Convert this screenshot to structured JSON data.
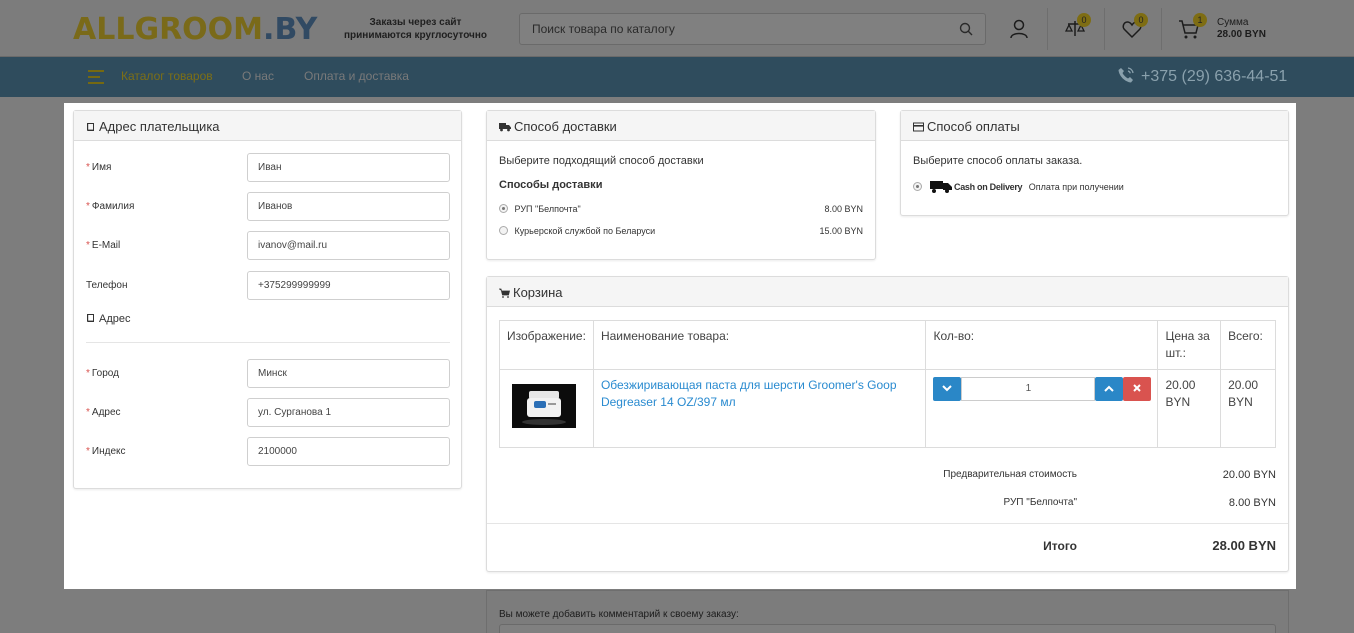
{
  "header": {
    "logo_part1": "ALLGROOM",
    "logo_part2": ".BY",
    "tagline_line1": "Заказы через сайт",
    "tagline_line2": "принимаются круглосуточно",
    "search_placeholder": "Поиск товара по каталогу",
    "compare_count": "0",
    "wishlist_count": "0",
    "cart_count": "1",
    "cart_sum_label": "Сумма",
    "cart_sum_value": "28.00 BYN"
  },
  "nav": {
    "catalog": "Каталог товаров",
    "about": "О нас",
    "payment_delivery": "Оплата и доставка",
    "phone": "+375 (29) 636-44-51"
  },
  "payer": {
    "heading": "Адрес плательщика",
    "fields": [
      {
        "label": "Имя",
        "required": true,
        "value": "Иван"
      },
      {
        "label": "Фамилия",
        "required": true,
        "value": "Иванов"
      },
      {
        "label": "E-Mail",
        "required": true,
        "value": "ivanov@mail.ru"
      },
      {
        "label": "Телефон",
        "required": false,
        "value": "+375299999999"
      }
    ],
    "address_legend": "Адрес",
    "address_fields": [
      {
        "label": "Город",
        "required": true,
        "value": "Минск"
      },
      {
        "label": "Адрес",
        "required": true,
        "value": "ул. Сурганова 1"
      },
      {
        "label": "Индекс",
        "required": true,
        "value": "2100000"
      }
    ]
  },
  "delivery": {
    "heading": "Способ доставки",
    "intro": "Выберите подходящий способ доставки",
    "subheading": "Способы доставки",
    "options": [
      {
        "name": "РУП \"Белпочта\"",
        "price": "8.00 BYN",
        "selected": true
      },
      {
        "name": "Курьерской службой по Беларуси",
        "price": "15.00 BYN",
        "selected": false
      }
    ]
  },
  "payment": {
    "heading": "Способ оплаты",
    "intro": "Выберите способ оплаты заказа.",
    "logo_text": "Cash on Delivery",
    "option_label": "Оплата при получении"
  },
  "cart": {
    "heading": "Корзина",
    "columns": [
      "Изображение:",
      "Наименование товара:",
      "Кол-во:",
      "Цена за шт.:",
      "Всего:"
    ],
    "item": {
      "name": "Обезжиривающая паста для шерсти Groomer's Goop Degreaser 14 OZ/397 мл",
      "qty": "1",
      "price": "20.00 BYN",
      "total": "20.00 BYN"
    },
    "subtotal_label": "Предварительная стоимость",
    "subtotal_value": "20.00 BYN",
    "shipping_label": "РУП \"Белпочта\"",
    "shipping_value": "8.00 BYN",
    "total_label": "Итого",
    "total_value": "28.00 BYN"
  },
  "comment": {
    "label": "Вы можете добавить комментарий к своему заказу:"
  },
  "colors": {
    "accent_blue": "#2a8bd0",
    "button_blue": "#2a87c7",
    "remove_red": "#d9534f",
    "required_star": "#d9534f"
  }
}
